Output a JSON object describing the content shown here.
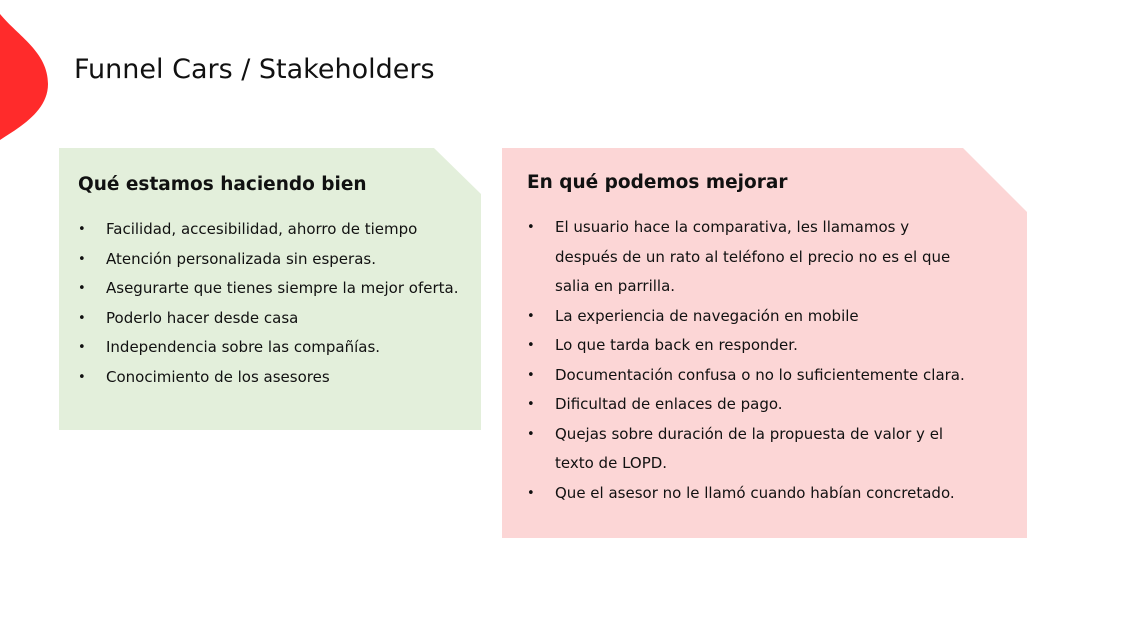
{
  "slide": {
    "title": "Funnel Cars / Stakeholders",
    "accent_color": "#ff2b2b"
  },
  "panels": {
    "left": {
      "heading": "Qué estamos haciendo bien",
      "background": "#e3efdb",
      "items": [
        "Facilidad, accesibilidad, ahorro de tiempo",
        "Atención personalizada sin esperas.",
        "Asegurarte que tienes siempre la mejor oferta.",
        "Poderlo hacer desde casa",
        "Independencia sobre las compañías.",
        "Conocimiento de los asesores"
      ]
    },
    "right": {
      "heading": "En qué podemos mejorar",
      "background": "#fcd6d6",
      "items": [
        "El usuario hace la comparativa, les llamamos y después de un rato al teléfono el precio no es el que salia en parrilla.",
        "La experiencia de navegación en mobile",
        "Lo que tarda back en responder.",
        "Documentación confusa o no lo suficientemente clara.",
        "Dificultad de enlaces de pago.",
        "Quejas sobre duración de la propuesta de valor y el texto de LOPD.",
        "Que el asesor no le llamó cuando habían concretado."
      ]
    }
  },
  "icons": {
    "accent": "red-leaf-shape",
    "bullet": "•"
  }
}
